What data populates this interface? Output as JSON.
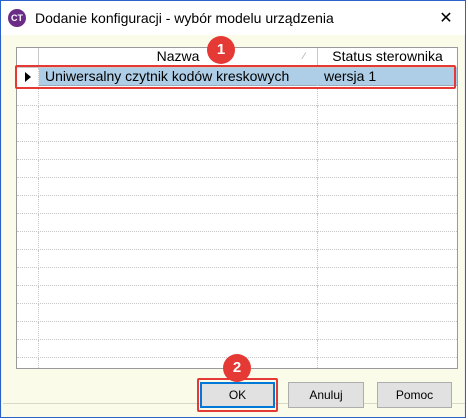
{
  "window": {
    "title": "Dodanie konfiguracji - wybór modelu urządzenia",
    "app_icon_text": "CT",
    "close_symbol": "✕"
  },
  "grid": {
    "columns": [
      "Nazwa",
      "Status sterownika"
    ],
    "rows": [
      {
        "name": "Uniwersalny czytnik kodów kreskowych",
        "status": "wersja 1",
        "selected": true
      }
    ],
    "empty_row_count": 16
  },
  "annotations": {
    "badge_1": "1",
    "badge_2": "2"
  },
  "buttons": {
    "ok": "OK",
    "cancel": "Anuluj",
    "help": "Pomoc"
  },
  "colors": {
    "selection": "#aecde6",
    "highlight": "#e53935",
    "background": "#fbfbea"
  }
}
